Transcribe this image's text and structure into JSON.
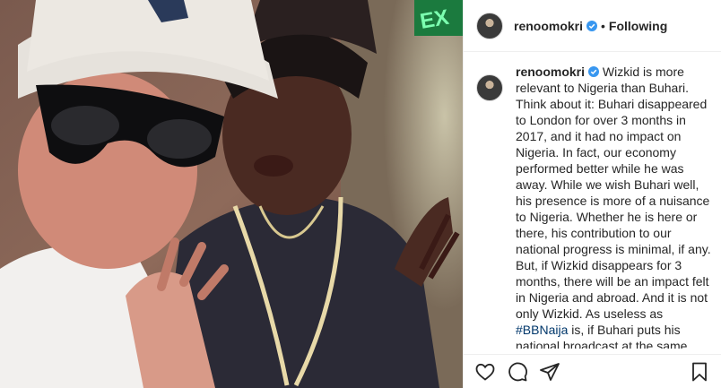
{
  "header": {
    "username": "renoomokri",
    "separator": "•",
    "follow_status": "Following"
  },
  "photo": {
    "exit_sign_text": "EX"
  },
  "caption": {
    "username": "renoomokri",
    "text_before_hashtag": "Wizkid is more relevant to Nigeria than Buhari. Think about it: Buhari disappeared to London for over 3 months in 2017, and it had no impact on Nigeria. In fact, our economy performed better while he was away. While we wish Buhari well, his presence is more of a nuisance to Nigeria. Whether he is here or there, his contribution to our national progress is minimal, if any. But, if Wizkid disappears for 3 months, there will be an impact felt in Nigeria and abroad. And it is not only Wizkid. As useless as ",
    "hashtag": "#BBNaija",
    "text_after_hashtag": " is, if Buhari puts his national broadcast at the same time as BBNaija, even his wife, Aisha, will not"
  },
  "icons": {
    "like": "heart-icon",
    "comment": "comment-icon",
    "share": "paper-plane-icon",
    "save": "bookmark-icon",
    "verified": "verified-badge-icon"
  },
  "colors": {
    "verified": "#3897f0",
    "hashtag": "#00376b",
    "text": "#262626",
    "exit_sign": "#2fd36a"
  }
}
